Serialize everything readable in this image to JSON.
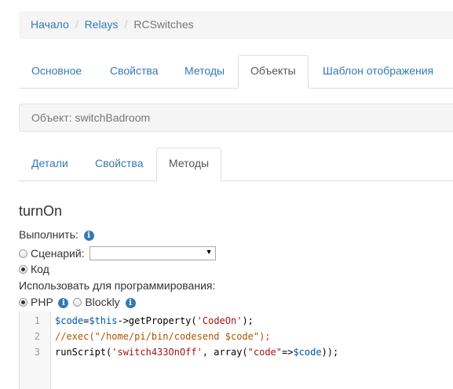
{
  "breadcrumb": {
    "items": [
      "Начало",
      "Relays",
      "RCSwitches"
    ],
    "separator": "/"
  },
  "main_tabs": [
    {
      "label": "Основное",
      "active": false
    },
    {
      "label": "Свойства",
      "active": false
    },
    {
      "label": "Методы",
      "active": false
    },
    {
      "label": "Объекты",
      "active": true
    },
    {
      "label": "Шаблон отображения",
      "active": false
    }
  ],
  "object_bar": {
    "text": "Объект: switchBadroom"
  },
  "sub_tabs": [
    {
      "label": "Детали",
      "active": false
    },
    {
      "label": "Свойства",
      "active": false
    },
    {
      "label": "Методы",
      "active": true
    }
  ],
  "method": {
    "title": "turnOn",
    "execute_label": "Выполнить:",
    "scenario_label": "Сценарий:",
    "scenario_value": "",
    "code_label": "Код",
    "code_selected": true,
    "programming_label": "Использовать для программирования:",
    "php_label": "PHP",
    "php_selected": true,
    "blockly_label": "Blockly"
  },
  "info_icon_glyph": "i",
  "editor": {
    "line_numbers": [
      "1",
      "2",
      "3"
    ],
    "lines": [
      "$code=$this->getProperty('CodeOn');",
      "//exec(\"/home/pi/bin/codesend $code\");",
      "runScript('switch433OnOff', array(\"code\"=>$code));"
    ]
  },
  "colors": {
    "link": "#337ab7",
    "variable": "#0055aa",
    "string": "#aa1111",
    "comment": "#aa5500"
  }
}
